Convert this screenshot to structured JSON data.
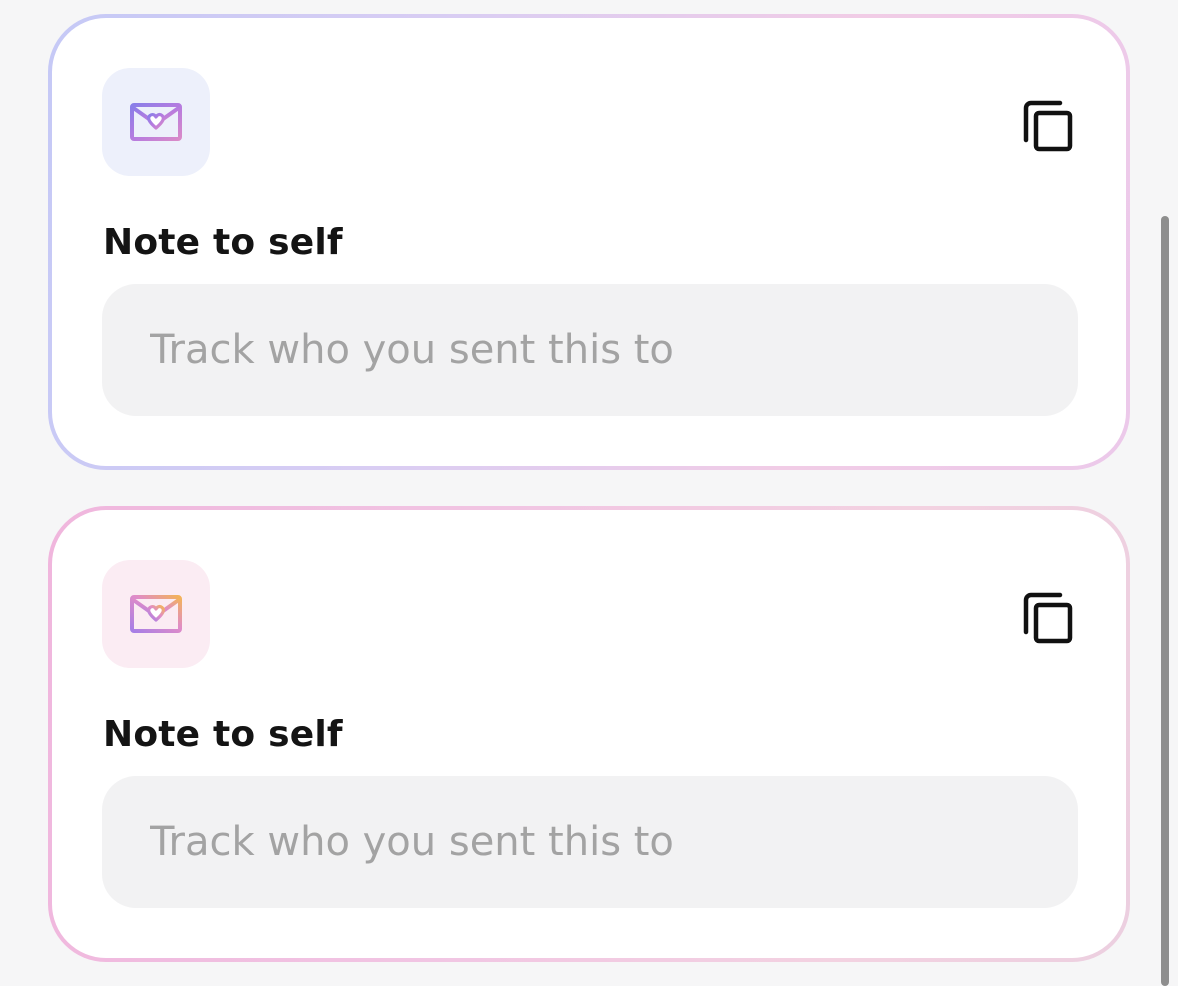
{
  "cards": [
    {
      "icon": "envelope-heart-icon",
      "accent": "#7b83e6",
      "note_label": "Note to self",
      "note_placeholder": "Track who you sent this to",
      "copy_icon": "copy-icon"
    },
    {
      "icon": "envelope-heart-icon",
      "accent": "#e58acb",
      "note_label": "Note to self",
      "note_placeholder": "Track who you sent this to",
      "copy_icon": "copy-icon"
    }
  ]
}
